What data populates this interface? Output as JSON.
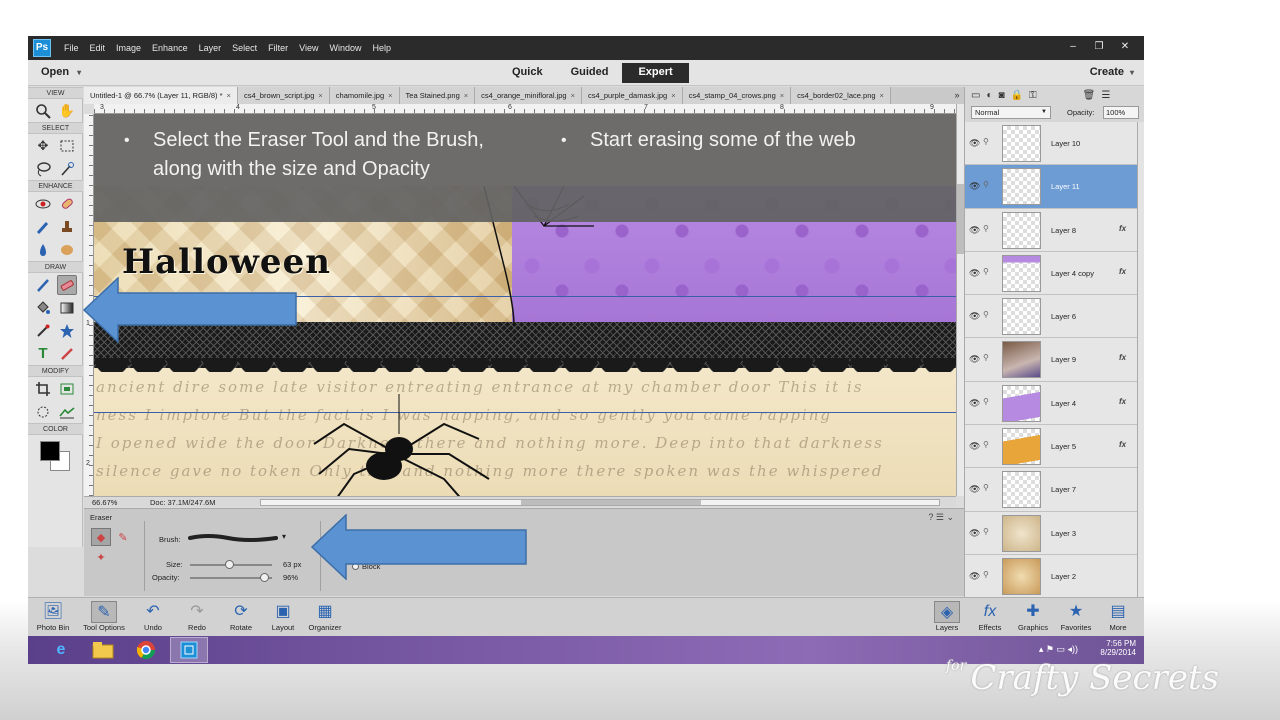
{
  "titlebar": {
    "app_icon": "photoshop-elements-icon",
    "menu": [
      "File",
      "Edit",
      "Image",
      "Enhance",
      "Layer",
      "Select",
      "Filter",
      "View",
      "Window",
      "Help"
    ],
    "window_buttons": [
      "–",
      "❐",
      "✕"
    ]
  },
  "modebar": {
    "open_label": "Open",
    "modes": [
      "Quick",
      "Guided",
      "Expert"
    ],
    "active_mode": "Expert",
    "create_label": "Create"
  },
  "toolbox": {
    "sections": {
      "view": "VIEW",
      "select": "SELECT",
      "enhance": "ENHANCE",
      "draw": "DRAW",
      "modify": "MODIFY",
      "color": "COLOR"
    },
    "selected_tool": "eraser-tool",
    "foreground_color": "#000000",
    "background_color": "#ffffff"
  },
  "document_tabs": [
    {
      "label": "Untitled-1 @ 66.7% (Layer 11, RGB/8) *",
      "active": true
    },
    {
      "label": "cs4_brown_script.jpg",
      "active": false
    },
    {
      "label": "chamomile.jpg",
      "active": false
    },
    {
      "label": "Tea Stained.png",
      "active": false
    },
    {
      "label": "cs4_orange_minifloral.jpg",
      "active": false
    },
    {
      "label": "cs4_purple_damask.jpg",
      "active": false
    },
    {
      "label": "cs4_stamp_04_crows.png",
      "active": false
    },
    {
      "label": "cs4_border02_lace.png",
      "active": false
    }
  ],
  "tabs_more": "»",
  "ruler": {
    "top": [
      "3",
      "4",
      "5",
      "6",
      "7",
      "8",
      "9"
    ],
    "left": [
      "1",
      "2"
    ]
  },
  "canvas": {
    "halloween_text": "Halloween",
    "script_lines": [
      "ancient dire some late visitor entreating entrance at my chamber door This it is",
      "ness I implore  But the fact is I was napping, and so gently you came rapping",
      "I opened wide the door  Darkness there and nothing more.  Deep into that darkness",
      "silence gave no token  Only this and nothing more  there spoken was the whispered"
    ]
  },
  "overlay": {
    "bullet_1": "Select the Eraser Tool and the Brush, along with the size and Opacity",
    "bullet_2": "Start erasing some of the web"
  },
  "statusbar": {
    "zoom": "66.67%",
    "doc_size": "Doc: 37.1M/247.6M"
  },
  "tool_options": {
    "title": "Eraser",
    "brush_label": "Brush:",
    "size_label": "Size:",
    "size_value": "63 px",
    "size_fraction": 0.48,
    "opacity_label": "Opacity:",
    "opacity_value": "96%",
    "opacity_fraction": 0.96,
    "block_label": "Block"
  },
  "layers_panel": {
    "blend_mode": "Normal",
    "opacity_label": "Opacity:",
    "opacity_value": "100%",
    "layers": [
      {
        "name": "Layer 10",
        "fx": false,
        "active": false
      },
      {
        "name": "Layer 11",
        "fx": false,
        "active": true
      },
      {
        "name": "Layer 8",
        "fx": true,
        "active": false
      },
      {
        "name": "Layer 4 copy",
        "fx": true,
        "active": false
      },
      {
        "name": "Layer 6",
        "fx": false,
        "active": false
      },
      {
        "name": "Layer 9",
        "fx": true,
        "active": false
      },
      {
        "name": "Layer 4",
        "fx": true,
        "active": false
      },
      {
        "name": "Layer 5",
        "fx": true,
        "active": false
      },
      {
        "name": "Layer 7",
        "fx": false,
        "active": false
      },
      {
        "name": "Layer 3",
        "fx": false,
        "active": false
      },
      {
        "name": "Layer 2",
        "fx": false,
        "active": false
      }
    ],
    "fx_label": "fx"
  },
  "bottombar": {
    "left": [
      "Photo Bin",
      "Tool Options",
      "Undo",
      "Redo",
      "Rotate",
      "Layout",
      "Organizer"
    ],
    "right": [
      "Layers",
      "Effects",
      "Graphics",
      "Favorites",
      "More"
    ]
  },
  "taskbar": {
    "items": [
      "internet-explorer-icon",
      "file-explorer-icon",
      "chrome-icon",
      "photoshop-elements-icon"
    ],
    "time": "7:56 PM",
    "date": "8/29/2014"
  },
  "watermark": {
    "prefix": "for",
    "text": "Crafty Secrets"
  },
  "colors": {
    "arrow": "#5b92d2",
    "active_layer": "#6d9bd3",
    "taskbar": "#7a5aa5"
  }
}
